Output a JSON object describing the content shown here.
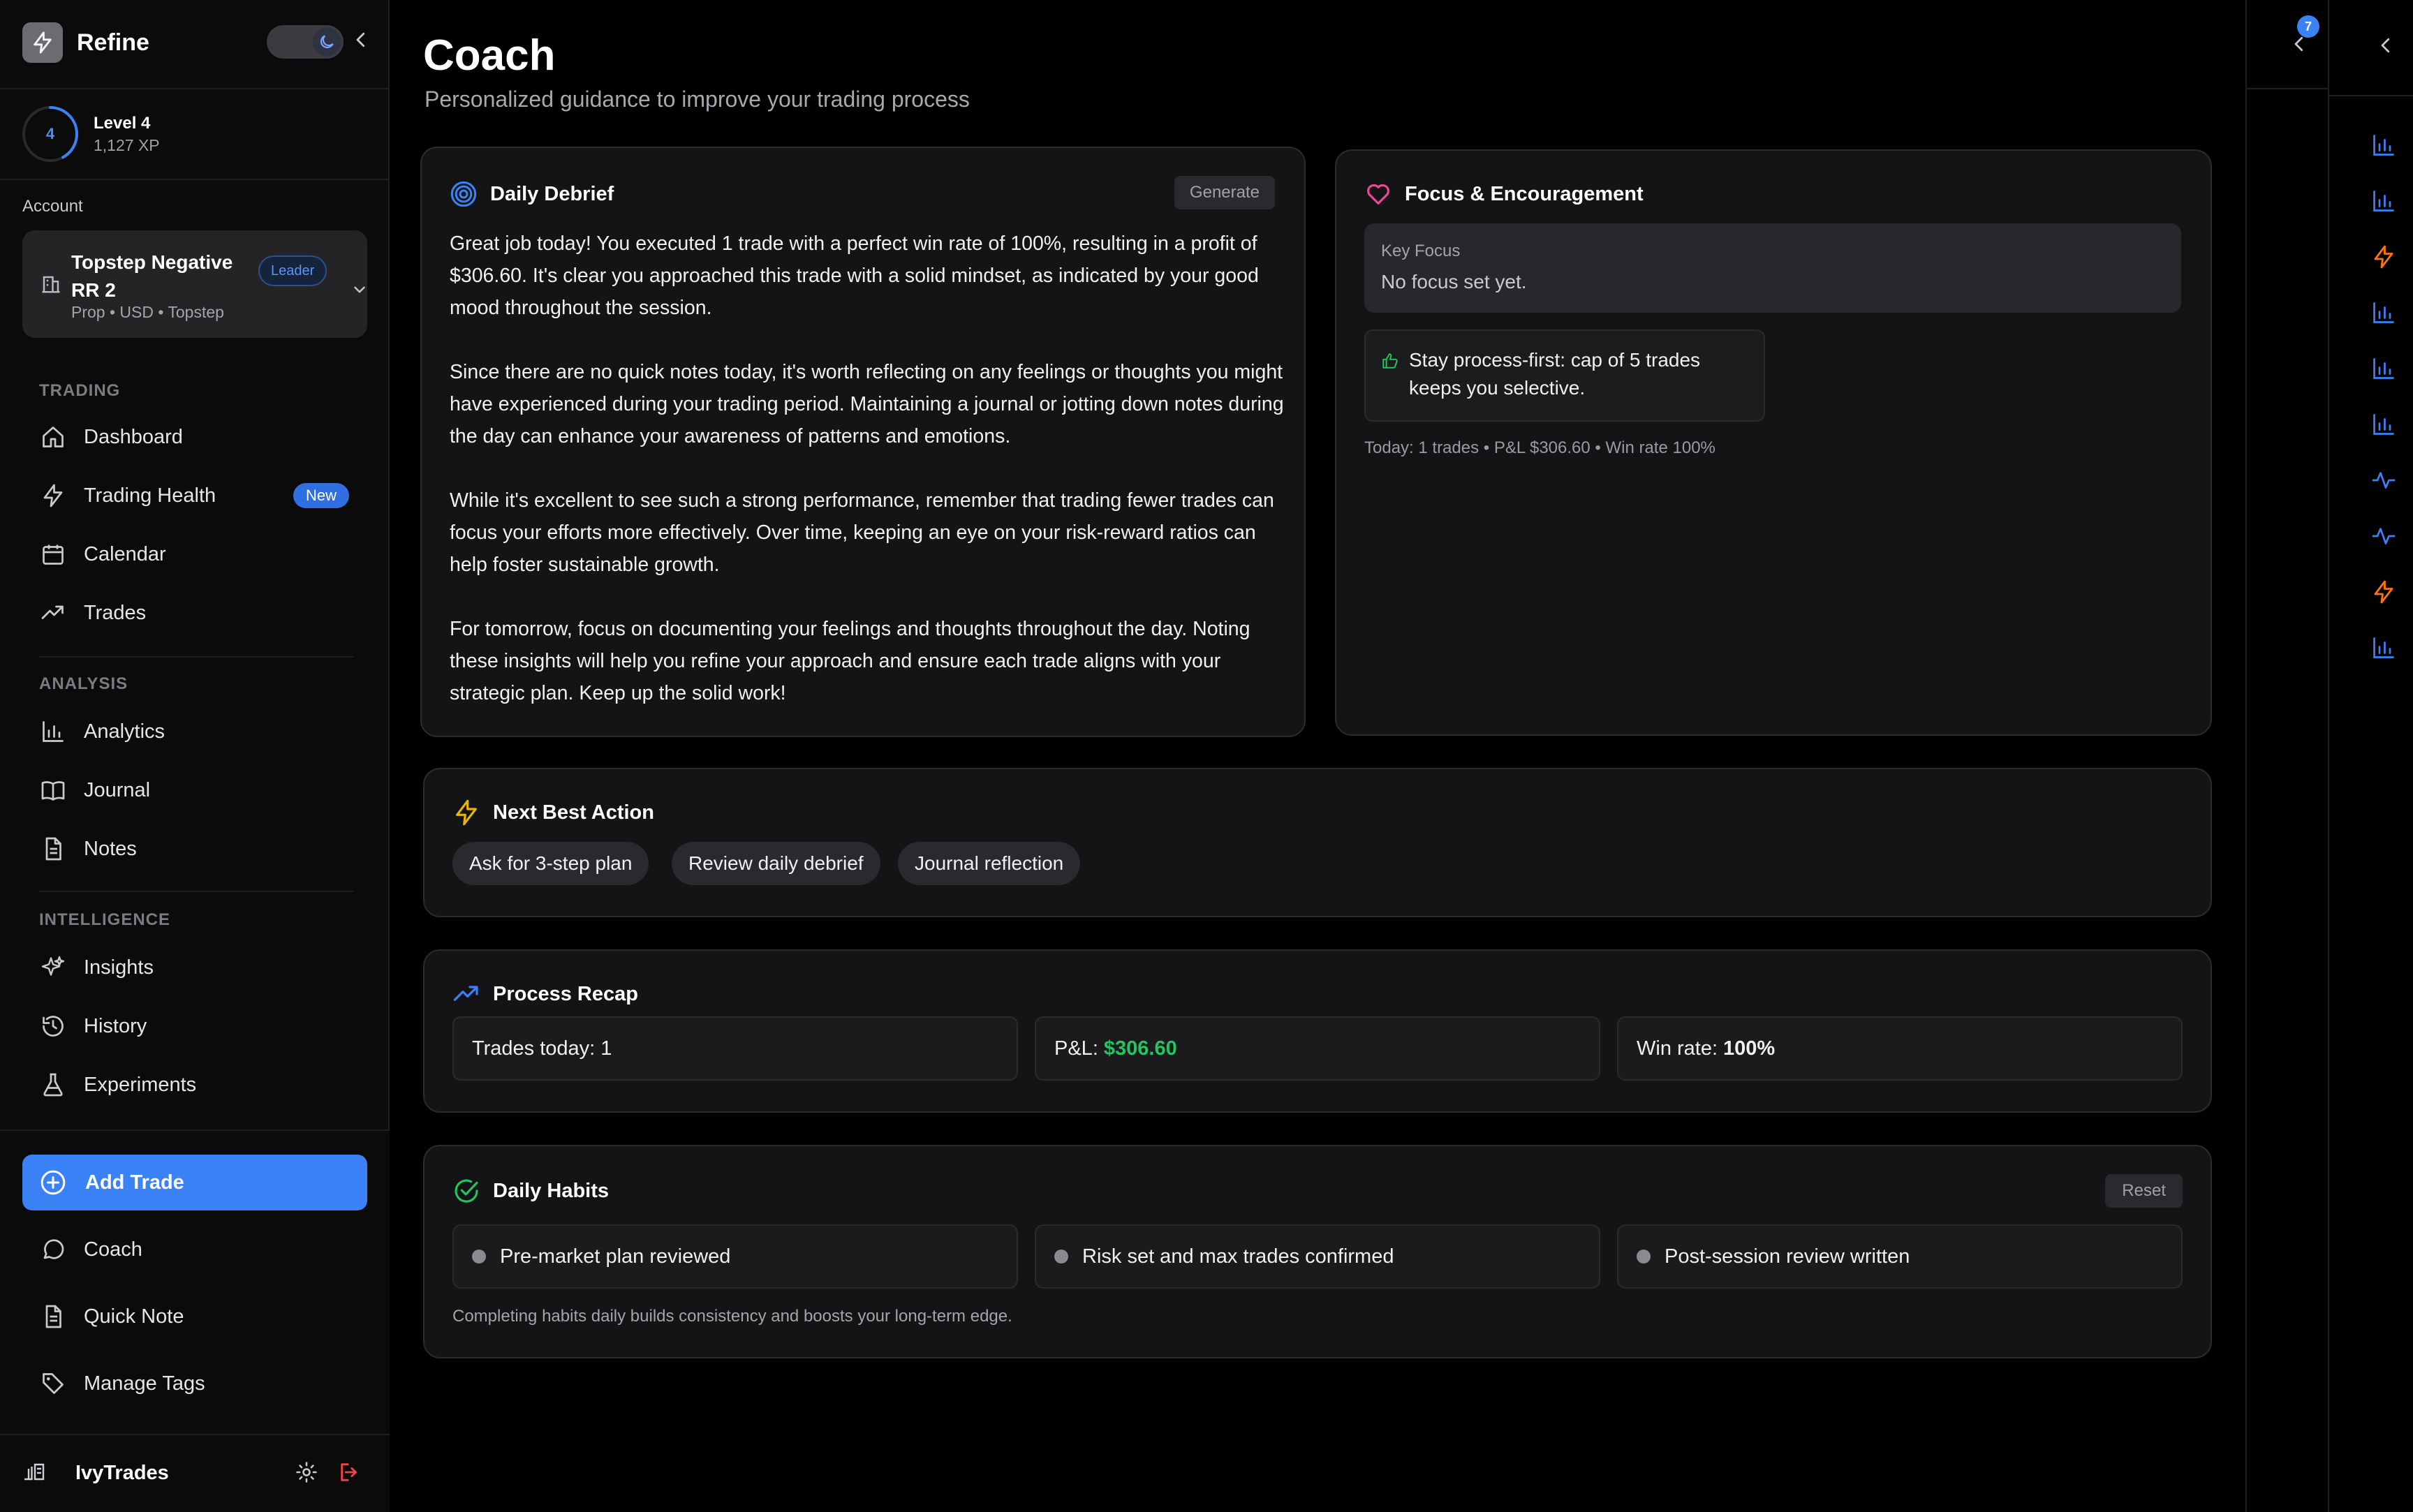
{
  "app": {
    "name": "Refine"
  },
  "level": {
    "number": "4",
    "title": "Level 4",
    "xp": "1,127 XP",
    "progress": 0.42
  },
  "account": {
    "label": "Account",
    "name": "Topstep Negative RR 2",
    "details": "Prop • USD • Topstep",
    "badge": "Leader"
  },
  "sidebar": {
    "trading_label": "TRADING",
    "trading": [
      {
        "label": "Dashboard",
        "icon": "home-icon"
      },
      {
        "label": "Trading Health",
        "icon": "bolt-icon",
        "badge": "New"
      },
      {
        "label": "Calendar",
        "icon": "calendar-icon"
      },
      {
        "label": "Trades",
        "icon": "trending-up-icon"
      }
    ],
    "analysis_label": "ANALYSIS",
    "analysis": [
      {
        "label": "Analytics",
        "icon": "bar-chart-icon"
      },
      {
        "label": "Journal",
        "icon": "book-icon"
      },
      {
        "label": "Notes",
        "icon": "document-icon"
      }
    ],
    "intelligence_label": "INTELLIGENCE",
    "intelligence": [
      {
        "label": "Insights",
        "icon": "sparkles-icon"
      },
      {
        "label": "History",
        "icon": "history-icon"
      },
      {
        "label": "Experiments",
        "icon": "flask-icon"
      }
    ],
    "add_trade": "Add Trade",
    "bottom": [
      {
        "label": "Coach",
        "icon": "chat-icon"
      },
      {
        "label": "Quick Note",
        "icon": "document-icon"
      },
      {
        "label": "Manage Tags",
        "icon": "tag-icon"
      }
    ],
    "user": "IvyTrades"
  },
  "page": {
    "title": "Coach",
    "subtitle": "Personalized guidance to improve your trading process"
  },
  "debrief": {
    "title": "Daily Debrief",
    "generate": "Generate",
    "paragraphs": [
      "Great job today! You executed 1 trade with a perfect win rate of 100%, resulting in a profit of $306.60. It's clear you approached this trade with a solid mindset, as indicated by your good mood throughout the session.",
      "Since there are no quick notes today, it's worth reflecting on any feelings or thoughts you might have experienced during your trading period. Maintaining a journal or jotting down notes during the day can enhance your awareness of patterns and emotions.",
      "While it's excellent to see such a strong performance, remember that trading fewer trades can focus your efforts more effectively. Over time, keeping an eye on your risk-reward ratios can help foster sustainable growth.",
      "For tomorrow, focus on documenting your feelings and thoughts throughout the day. Noting these insights will help you refine your approach and ensure each trade aligns with your strategic plan. Keep up the solid work!"
    ]
  },
  "focus": {
    "title": "Focus & Encouragement",
    "key_focus_label": "Key Focus",
    "key_focus_value": "No focus set yet.",
    "encouragement": "Stay process-first: cap of 5 trades keeps you selective.",
    "stats": "Today: 1 trades • P&L $306.60 • Win rate 100%"
  },
  "next_action": {
    "title": "Next Best Action",
    "options": [
      "Ask for 3-step plan",
      "Review daily debrief",
      "Journal reflection"
    ]
  },
  "recap": {
    "title": "Process Recap",
    "trades_label": "Trades today:",
    "trades_value": "1",
    "pnl_label": "P&L:",
    "pnl_value": "$306.60",
    "winrate_label": "Win rate:",
    "winrate_value": "100%"
  },
  "habits": {
    "title": "Daily Habits",
    "reset": "Reset",
    "items": [
      "Pre-market plan reviewed",
      "Risk set and max trades confirmed",
      "Post-session review written"
    ],
    "note": "Completing habits daily builds consistency and boosts your long-term edge."
  },
  "rail": {
    "notifications": "7",
    "icons": [
      "bar-chart-icon",
      "bar-chart-icon",
      "bolt-icon",
      "bar-chart-icon",
      "bar-chart-icon",
      "bar-chart-icon",
      "pulse-icon",
      "pulse-icon",
      "bolt-icon",
      "bar-chart-icon"
    ]
  },
  "colors": {
    "accent": "#3b82f6",
    "positive": "#22c55e",
    "warning": "#f97316",
    "heart": "#ec4899",
    "bolt": "#eab308"
  }
}
